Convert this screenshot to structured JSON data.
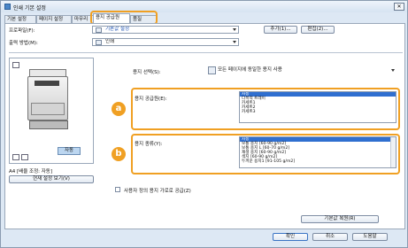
{
  "window": {
    "title": "인쇄 기본 설정",
    "close_glyph": "✕"
  },
  "tabs": [
    {
      "label": "기본 설정"
    },
    {
      "label": "페이지 설정"
    },
    {
      "label": "마무리"
    },
    {
      "label": "용지 공급원"
    },
    {
      "label": "품질"
    }
  ],
  "top": {
    "profile_label": "프로파일(F):",
    "profile_value": "기본값 설정",
    "add_button": "추가(1)...",
    "edit_button": "편집(2)...",
    "output_label": "출력 방법(M):",
    "output_value": "인쇄"
  },
  "preview": {
    "auto_label": "자동",
    "status_text": "A4 [배율 조정: 자동]",
    "view_settings_button": "현재 설정 보기(V)"
  },
  "paper_select": {
    "label": "용지 선택(S):",
    "value": "모든 페이지에 동일한 용지 사용"
  },
  "source": {
    "label": "용지 공급원(E):",
    "items": [
      "자동",
      "다목적 트레이",
      "카세트1",
      "카세트2",
      "카세트3"
    ],
    "selected_index": 0,
    "badge": "a"
  },
  "paper_type": {
    "label": "용지 종류(Y):",
    "items": [
      "자동",
      "보통 용지 [60-90 g/m2]",
      "보통 용지 L [60-70 g/m2]",
      "재생 용지 [60-90 g/m2]",
      "색지 [60-90 g/m2]",
      "두꺼운 용지1 [91-105 g/m2]"
    ],
    "selected_index": 0,
    "badge": "b"
  },
  "custom_paper": {
    "label": "사용자 정의 용지 가로로 공급(Z)",
    "checked": false
  },
  "buttons": {
    "restore_defaults": "기본값 복원(R)",
    "ok": "확인",
    "cancel": "취소",
    "help": "도움말"
  }
}
